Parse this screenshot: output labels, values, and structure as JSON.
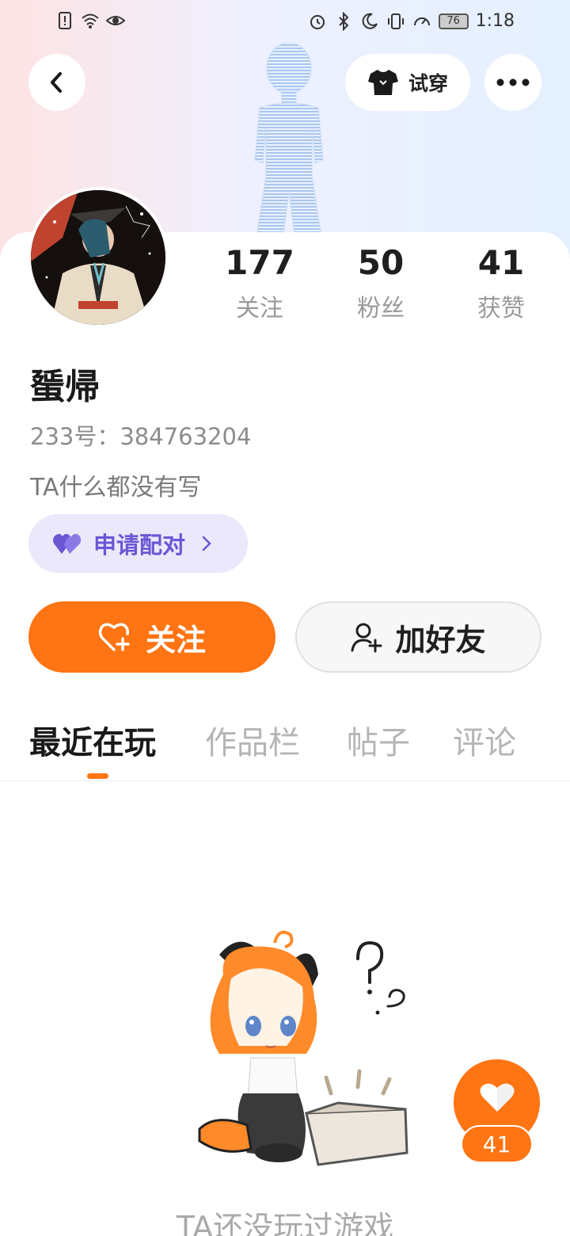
{
  "status_bar": {
    "time": "1:18",
    "battery": "76",
    "left_icons": [
      "alert-icon",
      "wifi-icon",
      "eye-icon"
    ],
    "right_icons": [
      "alarm-icon",
      "bluetooth-icon",
      "moon-icon",
      "vibrate-icon",
      "speed-icon"
    ]
  },
  "header": {
    "try_on_label": "试穿"
  },
  "profile": {
    "stats": [
      {
        "value": "177",
        "label": "关注"
      },
      {
        "value": "50",
        "label": "粉丝"
      },
      {
        "value": "41",
        "label": "获赞"
      }
    ],
    "name": "蜑帰",
    "id_text": "233号：384763204",
    "bio": "TA什么都没有写",
    "pair_label": "申请配对"
  },
  "actions": {
    "follow_label": "关注",
    "add_friend_label": "加好友"
  },
  "tabs": [
    "最近在玩",
    "作品栏",
    "帖子",
    "评论"
  ],
  "active_tab_index": 0,
  "empty_state": {
    "text": "TA还没玩过游戏"
  },
  "like_fab": {
    "count": "41"
  },
  "colors": {
    "accent": "#ff7413",
    "pair_bg": "#ebe8fb",
    "pair_text": "#6a57d4"
  }
}
